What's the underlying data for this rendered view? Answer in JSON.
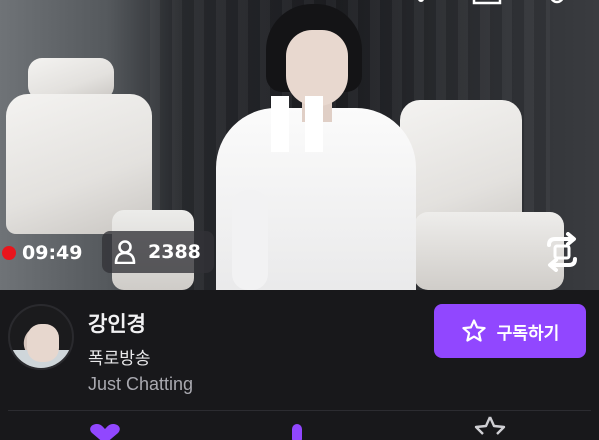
{
  "player": {
    "state": "paused",
    "live": true,
    "elapsed_time": "09:49",
    "viewer_count": "2388",
    "icons": [
      "pause-icon",
      "user-icon",
      "rotate-screen-icon"
    ]
  },
  "channel": {
    "name": "강인경",
    "stream_title": "폭로방송",
    "category": "Just Chatting"
  },
  "subscribe_button": {
    "label": "구독하기",
    "icon": "star-icon"
  },
  "colors": {
    "accent": "#9147ff",
    "live_red": "#e9151c",
    "background": "#18181b"
  }
}
